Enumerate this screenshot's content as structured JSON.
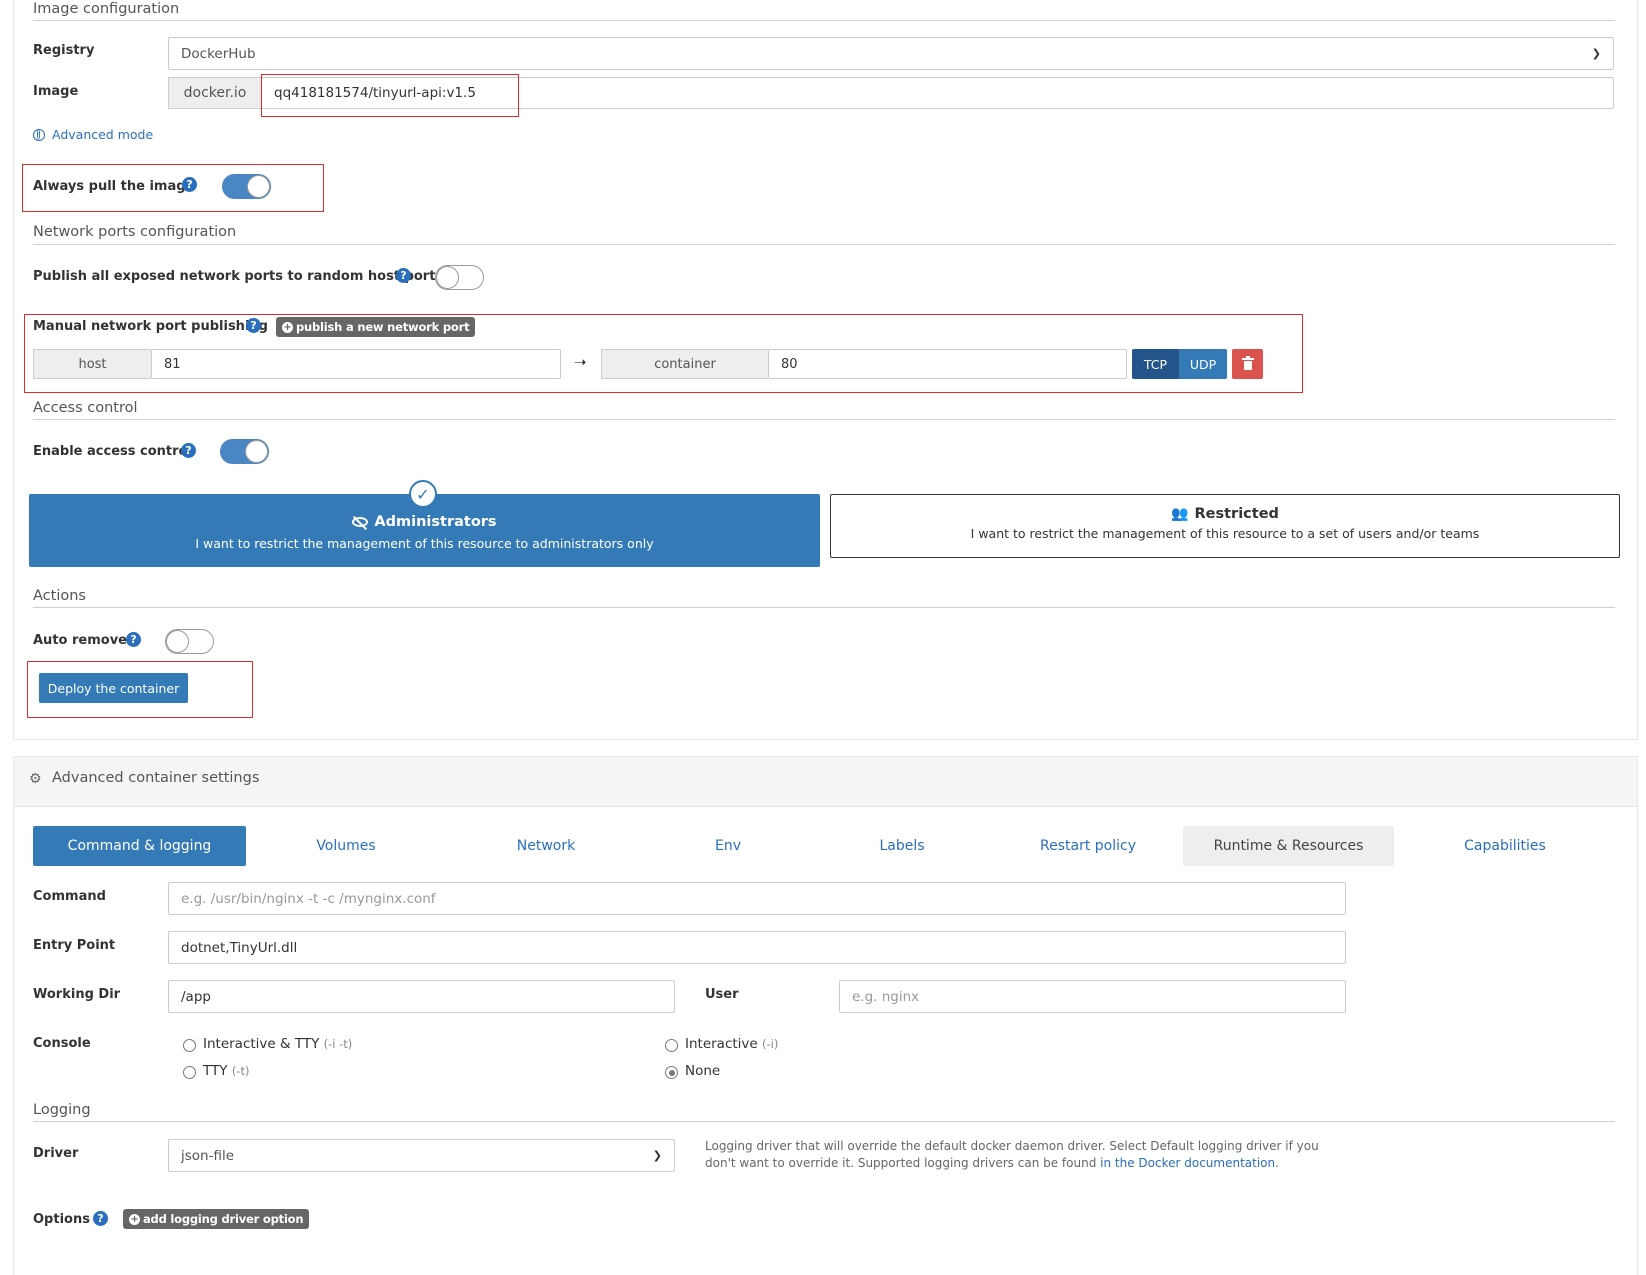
{
  "image_config": {
    "section_title": "Image configuration",
    "registry_label": "Registry",
    "registry_value": "DockerHub",
    "image_label": "Image",
    "image_prefix": "docker.io",
    "image_value": "qq418181574/tinyurl-api:v1.5",
    "advanced_mode": "Advanced mode",
    "always_pull_label": "Always pull the image",
    "always_pull_on": true
  },
  "network": {
    "section_title": "Network ports configuration",
    "publish_all_label": "Publish all exposed network ports to random host ports",
    "publish_all_on": false,
    "manual_label": "Manual network port publishing",
    "publish_button": "publish a new network port",
    "host_label": "host",
    "host_value": "81",
    "container_label": "container",
    "container_value": "80",
    "tcp_label": "TCP",
    "udp_label": "UDP"
  },
  "access": {
    "section_title": "Access control",
    "enable_label": "Enable access control",
    "enable_on": true,
    "admin_title": "Administrators",
    "admin_desc": "I want to restrict the management of this resource to administrators only",
    "restricted_title": "Restricted",
    "restricted_desc": "I want to restrict the management of this resource to a set of users and/or teams"
  },
  "actions": {
    "section_title": "Actions",
    "auto_remove_label": "Auto remove",
    "auto_remove_on": false,
    "deploy_button": "Deploy the container"
  },
  "advanced": {
    "header": "Advanced container settings",
    "tabs": [
      {
        "label": "Command & logging",
        "active": true
      },
      {
        "label": "Volumes"
      },
      {
        "label": "Network"
      },
      {
        "label": "Env"
      },
      {
        "label": "Labels"
      },
      {
        "label": "Restart policy"
      },
      {
        "label": "Runtime & Resources",
        "hover": true
      },
      {
        "label": "Capabilities"
      }
    ],
    "command_label": "Command",
    "command_placeholder": "e.g. /usr/bin/nginx -t -c /mynginx.conf",
    "entry_label": "Entry Point",
    "entry_value": "dotnet,TinyUrl.dll",
    "workdir_label": "Working Dir",
    "workdir_value": "/app",
    "user_label": "User",
    "user_placeholder": "e.g. nginx",
    "console_label": "Console",
    "console_options": [
      {
        "label": "Interactive & TTY",
        "hint": "(-i -t)",
        "checked": false
      },
      {
        "label": "Interactive",
        "hint": "(-i)",
        "checked": false
      },
      {
        "label": "TTY",
        "hint": "(-t)",
        "checked": false
      },
      {
        "label": "None",
        "hint": "",
        "checked": true
      }
    ],
    "logging_title": "Logging",
    "driver_label": "Driver",
    "driver_value": "json-file",
    "driver_help_1": "Logging driver that will override the default docker daemon driver. Select Default logging driver if you",
    "driver_help_2": "don't want to override it. Supported logging drivers can be found ",
    "driver_help_link": "in the Docker documentation",
    "driver_help_end": ".",
    "options_label": "Options",
    "add_option_button": "add logging driver option"
  },
  "colors": {
    "primary": "#337ab7",
    "danger": "#d9534f",
    "annotation": "#e32a2a"
  }
}
